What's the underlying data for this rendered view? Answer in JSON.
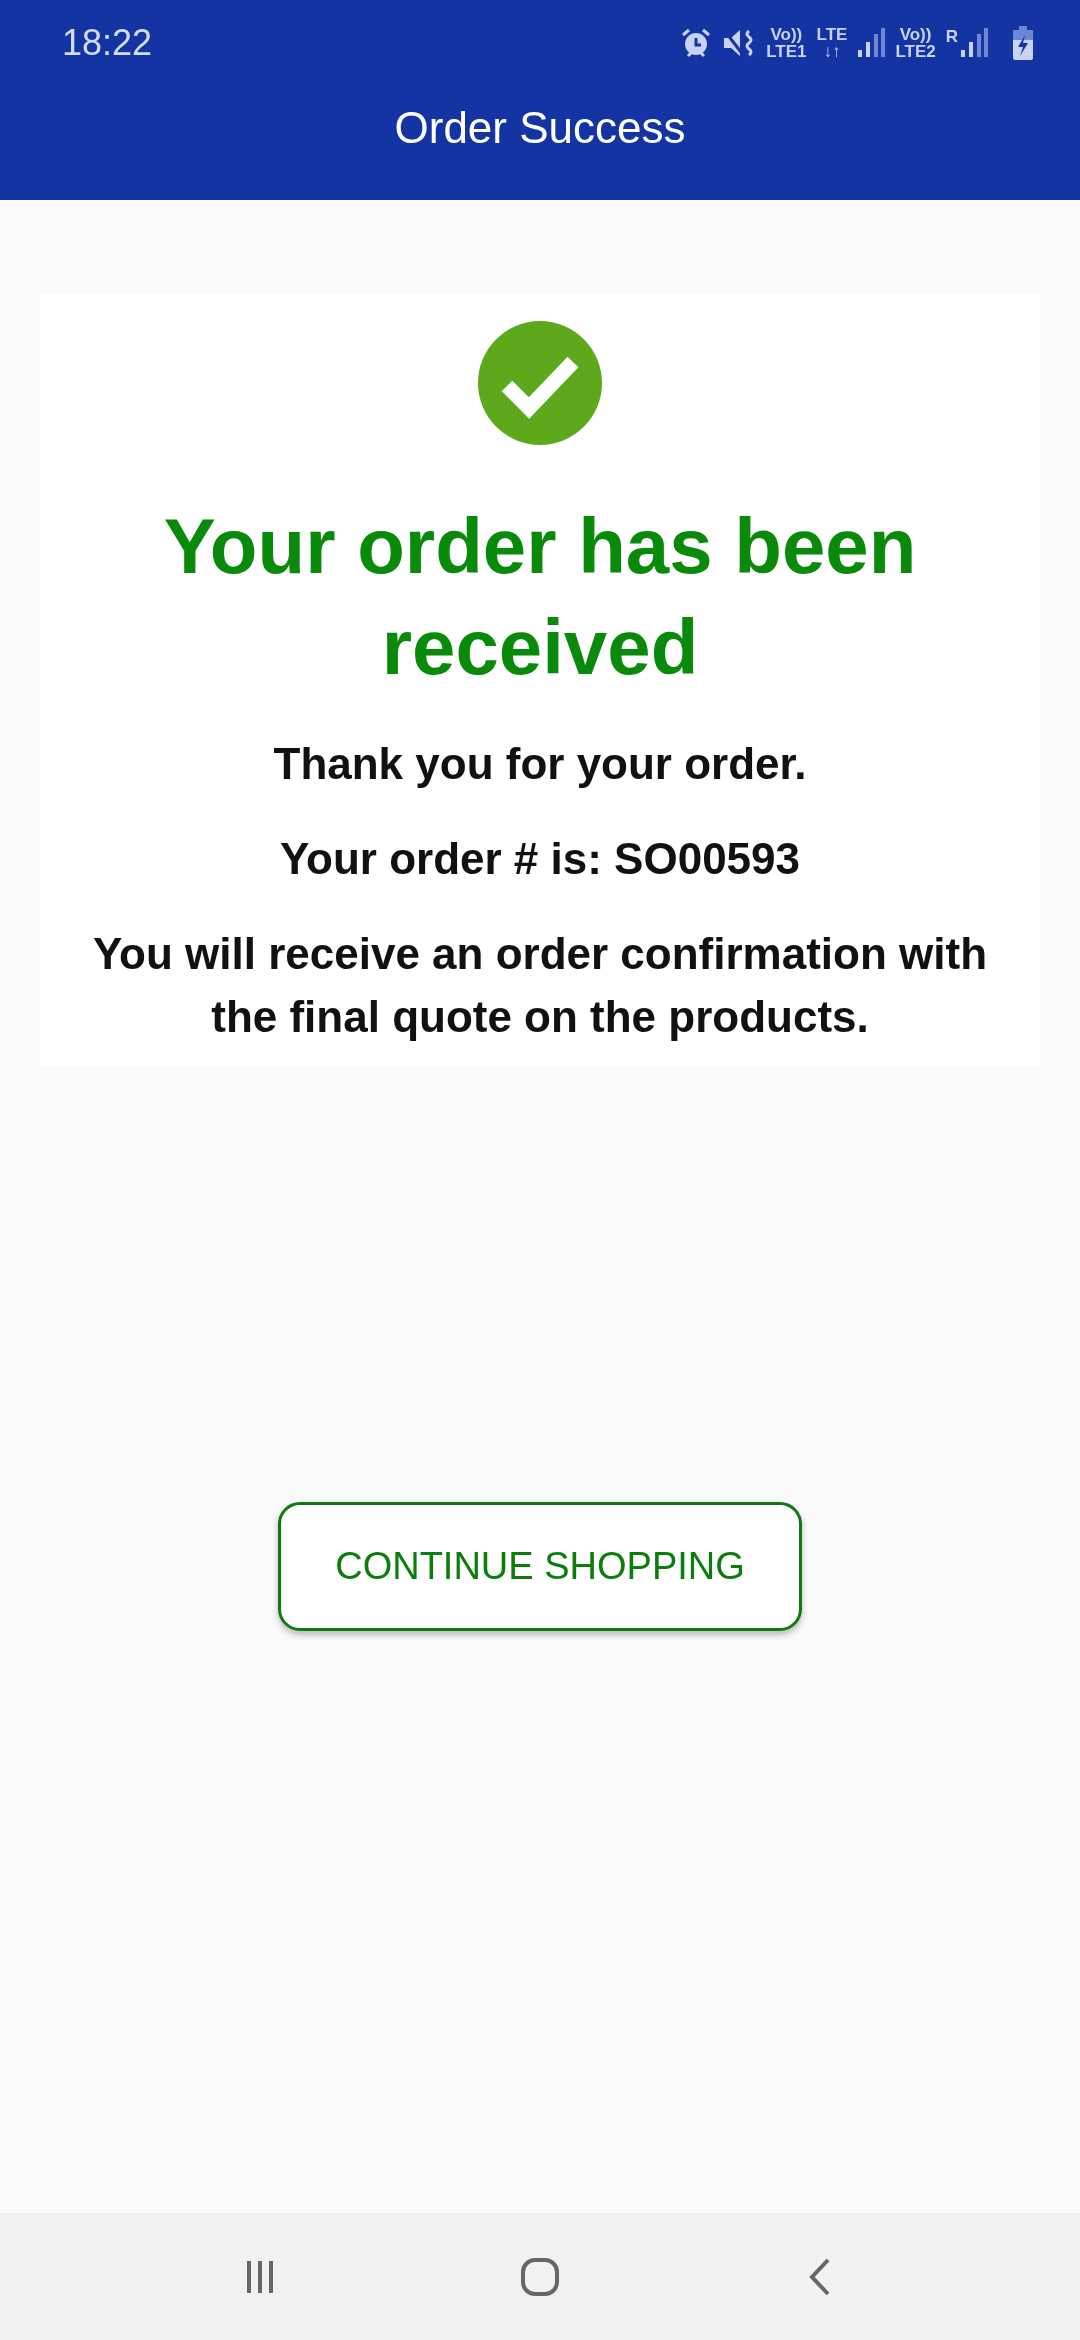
{
  "status_bar": {
    "time": "18:22",
    "indicators": [
      {
        "kind": "alarm"
      },
      {
        "kind": "mute"
      },
      {
        "kind": "text",
        "top": "Vo))",
        "bottom": "LTE1"
      },
      {
        "kind": "text",
        "top": "LTE",
        "bottom": "↓↑"
      },
      {
        "kind": "signal"
      },
      {
        "kind": "text",
        "top": "Vo))",
        "bottom": "LTE2"
      },
      {
        "kind": "signal",
        "label": "R"
      },
      {
        "kind": "battery"
      }
    ]
  },
  "app_bar": {
    "title": "Order Success"
  },
  "card": {
    "heading": "Your order has been received",
    "messages": [
      "Thank you for your order.",
      "Your order # is: SO00593",
      "You will receive an order confirmation with the final quote on the products."
    ]
  },
  "button": {
    "label": "CONTINUE SHOPPING"
  },
  "nav_bar": [
    {
      "kind": "recents"
    },
    {
      "kind": "home"
    },
    {
      "kind": "back"
    }
  ]
}
